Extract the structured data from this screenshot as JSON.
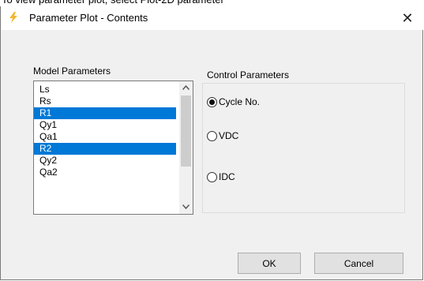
{
  "caption": "To view parameter plot, select Plot-2D parameter",
  "window": {
    "title": "Parameter Plot - Contents",
    "close_glyph": "✕",
    "icon": "lightning-app-icon"
  },
  "model_parameters": {
    "label": "Model Parameters",
    "items": [
      {
        "label": "Ls",
        "selected": false
      },
      {
        "label": "Rs",
        "selected": false
      },
      {
        "label": "R1",
        "selected": true
      },
      {
        "label": "Qy1",
        "selected": false
      },
      {
        "label": "Qa1",
        "selected": false
      },
      {
        "label": "R2",
        "selected": true
      },
      {
        "label": "Qy2",
        "selected": false
      },
      {
        "label": "Qa2",
        "selected": false
      }
    ],
    "scroll_up_glyph": "▲",
    "scroll_down_glyph": "▼"
  },
  "control_parameters": {
    "label": "Control Parameters",
    "options": [
      {
        "label": "Cycle No.",
        "checked": true
      },
      {
        "label": "VDC",
        "checked": false
      },
      {
        "label": "IDC",
        "checked": false
      }
    ]
  },
  "buttons": {
    "ok_label": "OK",
    "cancel_label": "Cancel"
  },
  "colors": {
    "selection": "#0078d7",
    "dialog_bg": "#f0f0f0"
  }
}
